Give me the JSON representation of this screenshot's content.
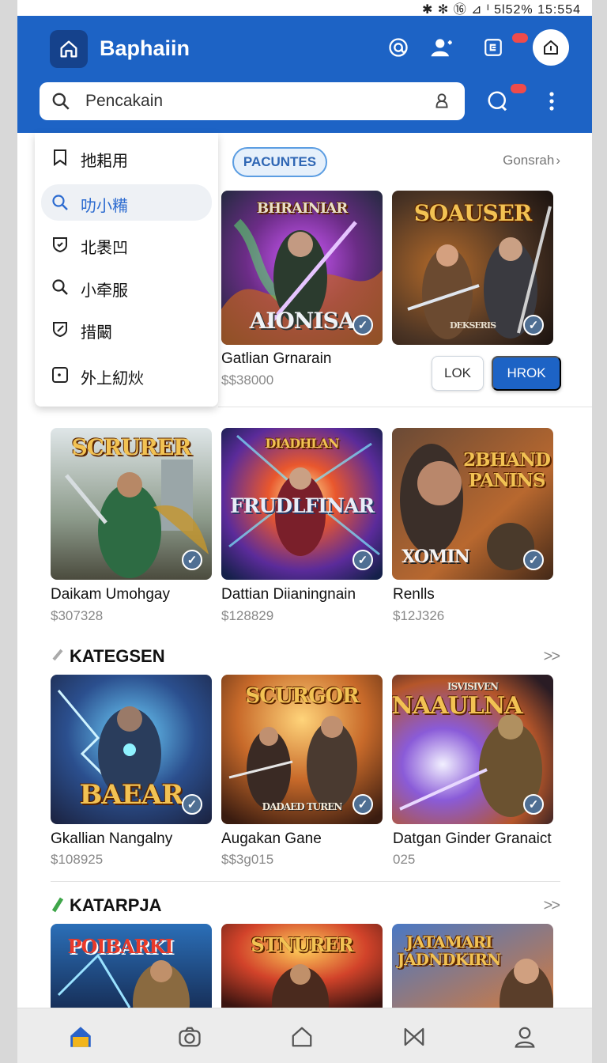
{
  "status_bar": {
    "indicators": "✱ ✻ ⑯ ⊿ ᴵ",
    "text": "5l52% 15:554"
  },
  "header": {
    "title": "Baphaiin",
    "icons": [
      "home-icon",
      "at-icon",
      "person-icon",
      "share-icon",
      "shop-home-icon"
    ],
    "search_placeholder": "Pencakain",
    "accent": "#1d63c5"
  },
  "dropdown": {
    "items": [
      {
        "label": "扡耜用",
        "icon": "bookmark-icon"
      },
      {
        "label": "叻小糒",
        "icon": "search-icon"
      },
      {
        "label": "北褁凹",
        "icon": "shield-icon"
      },
      {
        "label": "小牵服",
        "icon": "search-icon"
      },
      {
        "label": "措闞",
        "icon": "edit-icon"
      },
      {
        "label": "外上糿炏",
        "icon": "clock-icon"
      }
    ]
  },
  "featured": {
    "pill_label": "PACUNTES",
    "see_all": "Gonsrah",
    "see_all_chevron": "›",
    "cards": [
      {
        "art_text": "AIONISA",
        "art_top": "BHRAINIAR",
        "title": "Gatlian Grnarain",
        "price": "$$38000"
      },
      {
        "art_text": "SOAUSER",
        "art_sub": "DEKSERIS",
        "title": "",
        "price": ""
      }
    ],
    "btn_secondary": "LOK",
    "btn_primary": "HROK"
  },
  "grid_row": {
    "cards": [
      {
        "art_text": "SCRURER",
        "title": "Daikam Umohgay",
        "price": "$307328"
      },
      {
        "art_text": "FRUDLFINAR",
        "art_top": "DIADHLAN",
        "title": "Dattian Diianingnain",
        "price": "$128829"
      },
      {
        "art_text": "2BHAND PANINS",
        "art_sub": "XOMIN",
        "title": "Renlls",
        "price": "$12J326"
      }
    ]
  },
  "section_1": {
    "title": "KATEGSEN",
    "more": ">>",
    "cards": [
      {
        "art_text": "BAEAR",
        "title": "Gkallian Nangalny",
        "price": "$108925"
      },
      {
        "art_text": "SCURGOR",
        "art_sub": "DADAED TUREN",
        "title": "Augakan Gane",
        "price": "$$3g015"
      },
      {
        "art_text": "NAAULNA",
        "art_top": "ISVISIVEN",
        "title": "Datgan Ginder Granaict",
        "price": "025"
      }
    ]
  },
  "section_2": {
    "title": "KATARPJA",
    "more": ">>",
    "cards": [
      {
        "art_text": "POIBARKI"
      },
      {
        "art_text": "STNURER"
      },
      {
        "art_text": "JATAMARI JADNDKIRN"
      }
    ]
  },
  "bottom_nav": {
    "items": [
      "home-icon",
      "camera-icon",
      "house-outline-icon",
      "bookmark-icon",
      "profile-icon"
    ]
  },
  "check_glyph": "✓"
}
